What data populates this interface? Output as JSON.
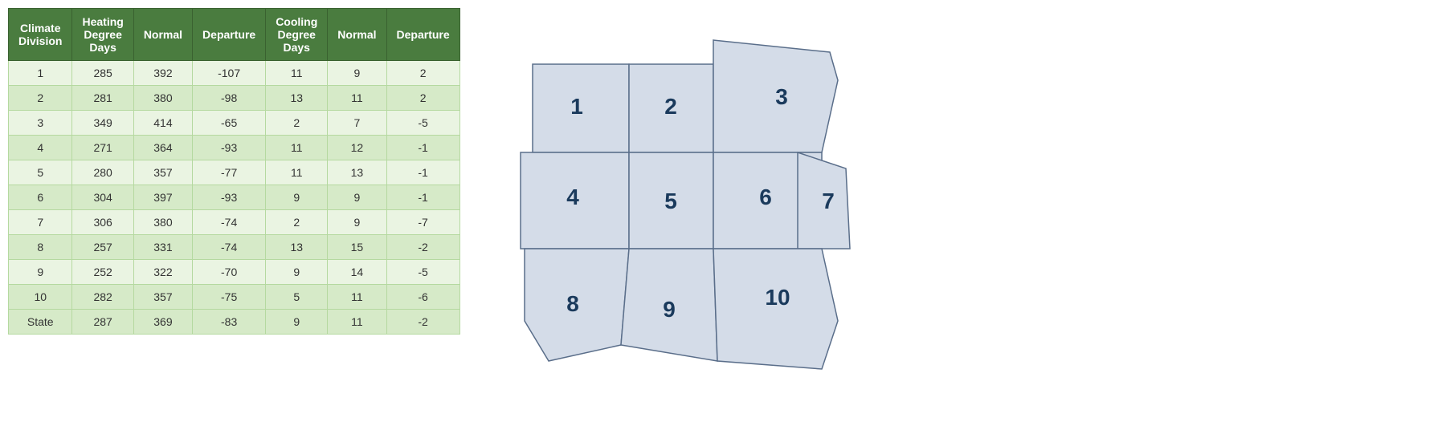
{
  "table": {
    "headers": [
      "Climate\nDivision",
      "Heating\nDegree\nDays",
      "Normal",
      "Departure",
      "Cooling\nDegree\nDays",
      "Normal",
      "Departure"
    ],
    "rows": [
      {
        "division": "1",
        "hdd": "285",
        "hdd_normal": "392",
        "hdd_dep": "-107",
        "cdd": "11",
        "cdd_normal": "9",
        "cdd_dep": "2"
      },
      {
        "division": "2",
        "hdd": "281",
        "hdd_normal": "380",
        "hdd_dep": "-98",
        "cdd": "13",
        "cdd_normal": "11",
        "cdd_dep": "2"
      },
      {
        "division": "3",
        "hdd": "349",
        "hdd_normal": "414",
        "hdd_dep": "-65",
        "cdd": "2",
        "cdd_normal": "7",
        "cdd_dep": "-5"
      },
      {
        "division": "4",
        "hdd": "271",
        "hdd_normal": "364",
        "hdd_dep": "-93",
        "cdd": "11",
        "cdd_normal": "12",
        "cdd_dep": "-1"
      },
      {
        "division": "5",
        "hdd": "280",
        "hdd_normal": "357",
        "hdd_dep": "-77",
        "cdd": "11",
        "cdd_normal": "13",
        "cdd_dep": "-1"
      },
      {
        "division": "6",
        "hdd": "304",
        "hdd_normal": "397",
        "hdd_dep": "-93",
        "cdd": "9",
        "cdd_normal": "9",
        "cdd_dep": "-1"
      },
      {
        "division": "7",
        "hdd": "306",
        "hdd_normal": "380",
        "hdd_dep": "-74",
        "cdd": "2",
        "cdd_normal": "9",
        "cdd_dep": "-7"
      },
      {
        "division": "8",
        "hdd": "257",
        "hdd_normal": "331",
        "hdd_dep": "-74",
        "cdd": "13",
        "cdd_normal": "15",
        "cdd_dep": "-2"
      },
      {
        "division": "9",
        "hdd": "252",
        "hdd_normal": "322",
        "hdd_dep": "-70",
        "cdd": "9",
        "cdd_normal": "14",
        "cdd_dep": "-5"
      },
      {
        "division": "10",
        "hdd": "282",
        "hdd_normal": "357",
        "hdd_dep": "-75",
        "cdd": "5",
        "cdd_normal": "11",
        "cdd_dep": "-6"
      },
      {
        "division": "State",
        "hdd": "287",
        "hdd_normal": "369",
        "hdd_dep": "-83",
        "cdd": "9",
        "cdd_normal": "11",
        "cdd_dep": "-2"
      }
    ]
  }
}
